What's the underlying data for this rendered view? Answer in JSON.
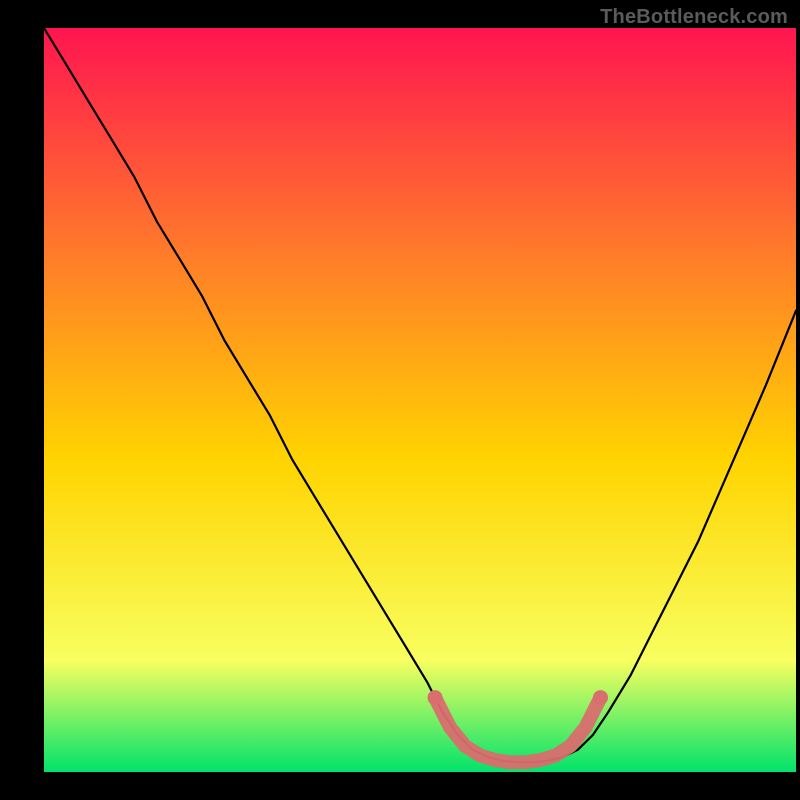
{
  "watermark": "TheBottleneck.com",
  "chart_data": {
    "type": "line",
    "title": "",
    "xlabel": "",
    "ylabel": "",
    "xlim": [
      0,
      100
    ],
    "ylim": [
      0,
      100
    ],
    "grid": false,
    "legend": false,
    "series": [
      {
        "name": "bottleneck-curve",
        "x": [
          0,
          3,
          6,
          9,
          12,
          15,
          18,
          21,
          24,
          27,
          30,
          33,
          36,
          39,
          42,
          45,
          48,
          51,
          53,
          55,
          57,
          59,
          61,
          63,
          65,
          67,
          69,
          71,
          73,
          75,
          78,
          81,
          84,
          87,
          90,
          93,
          96,
          100
        ],
        "y": [
          100,
          95,
          90,
          85,
          80,
          74,
          69,
          64,
          58,
          53,
          48,
          42,
          37,
          32,
          27,
          22,
          17,
          12,
          8,
          5,
          3,
          2,
          1.5,
          1.3,
          1.3,
          1.5,
          2,
          3,
          5,
          8,
          13,
          19,
          25,
          31,
          38,
          45,
          52,
          62
        ]
      },
      {
        "name": "bottom-segment",
        "x": [
          52,
          54,
          56,
          58,
          60,
          62,
          64,
          66,
          68,
          70,
          72,
          74
        ],
        "y": [
          10,
          6,
          3.5,
          2.2,
          1.6,
          1.3,
          1.3,
          1.6,
          2.2,
          3.5,
          6,
          10
        ]
      }
    ],
    "background_gradient": {
      "top": "#ff1550",
      "mid_upper": "#ff7a2a",
      "mid": "#ffd400",
      "mid_lower": "#f8ff60",
      "bottom": "#00e36b"
    },
    "plot_area_left_frac": 0.055,
    "plot_area_right_frac": 0.995,
    "plot_area_top_frac": 0.035,
    "plot_area_bottom_frac": 0.965,
    "bottom_segment_color": "#d96e6e",
    "curve_color": "#000000"
  }
}
